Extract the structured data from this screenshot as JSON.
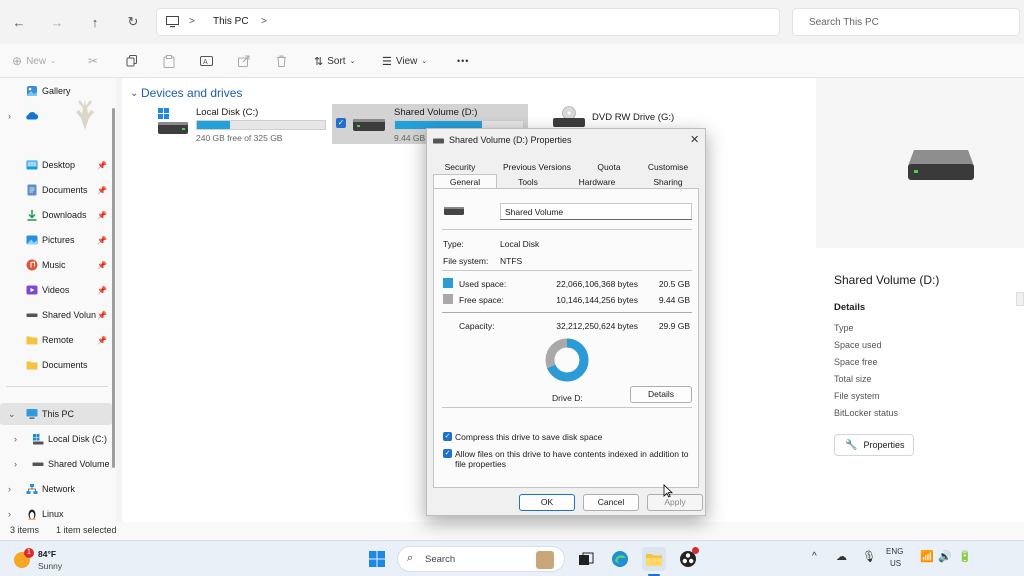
{
  "address": {
    "segment": "This PC",
    "sep1": ">",
    "sep2": ">"
  },
  "search": {
    "placeholder": "Search This PC"
  },
  "toolbar": {
    "new_label": "New",
    "sort_label": "Sort",
    "view_label": "View",
    "more": "•••"
  },
  "sidebar": {
    "gallery": "Gallery",
    "desktop": "Desktop",
    "documents": "Documents",
    "downloads": "Downloads",
    "pictures": "Pictures",
    "music": "Music",
    "videos": "Videos",
    "shared": "Shared Volun",
    "remote": "Remote",
    "documents2": "Documents",
    "thispc": "This PC",
    "localdisk": "Local Disk (C:)",
    "sharedvol": "Shared Volume",
    "network": "Network",
    "linux": "Linux"
  },
  "main": {
    "section_title": "Devices and drives",
    "drives": [
      {
        "name": "Local Disk (C:)",
        "free": "240 GB free of 325 GB",
        "fill": 0.26
      },
      {
        "name": "Shared Volume (D:)",
        "free": "9.44 GB",
        "fill": 0.68
      },
      {
        "name": "DVD RW Drive (G:)",
        "free": "",
        "fill": 0
      }
    ]
  },
  "details": {
    "title": "Shared Volume (D:)",
    "heading": "Details",
    "rows": [
      "Type",
      "Space used",
      "Space free",
      "Total size",
      "File system",
      "BitLocker status"
    ],
    "properties_button": "Properties"
  },
  "status": {
    "items": "3 items",
    "selected": "1 item selected"
  },
  "dialog": {
    "title": "Shared Volume (D:) Properties",
    "tabs_row1": [
      "Security",
      "Previous Versions",
      "Quota",
      "Customise"
    ],
    "tabs_row2": [
      "General",
      "Tools",
      "Hardware",
      "Sharing"
    ],
    "volume_name": "Shared Volume",
    "type_label": "Type:",
    "type_value": "Local Disk",
    "fs_label": "File system:",
    "fs_value": "NTFS",
    "used_label": "Used space:",
    "used_bytes": "22,066,106,368 bytes",
    "used_gb": "20.5 GB",
    "free_label": "Free space:",
    "free_bytes": "10,146,144,256 bytes",
    "free_gb": "9.44 GB",
    "cap_label": "Capacity:",
    "cap_bytes": "32,212,250,624 bytes",
    "cap_gb": "29.9 GB",
    "used_fraction": 0.685,
    "drive_label": "Drive D:",
    "details_button": "Details",
    "compress_label": "Compress this drive to save disk space",
    "index_label": "Allow files on this drive to have contents indexed in addition to file properties",
    "ok": "OK",
    "cancel": "Cancel",
    "apply": "Apply",
    "close_glyph": "✕",
    "colors": {
      "used": "#2b9bd8",
      "free": "#a9a9a9"
    }
  },
  "taskbar": {
    "temp": "84°F",
    "weather": "Sunny",
    "search": "Search",
    "lang": "ENG",
    "region": "US",
    "badge": "1",
    "chevron": "^"
  }
}
